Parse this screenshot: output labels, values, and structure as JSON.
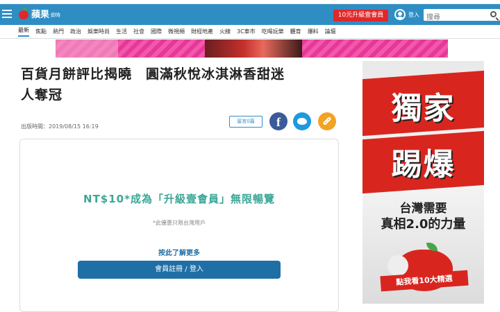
{
  "header": {
    "logo_name": "蘋果",
    "logo_sub": "即時",
    "upgrade_label": "10元升級壹會員",
    "login_label": "登入",
    "search_placeholder": "搜尋"
  },
  "nav": {
    "items": [
      "最新",
      "焦點",
      "熱門",
      "政治",
      "娛樂時尚",
      "生活",
      "社會",
      "國際",
      "微視頻",
      "財經地產",
      "火線",
      "3C車市",
      "吃喝玩樂",
      "體育",
      "爆料",
      "論壇"
    ]
  },
  "article": {
    "headline_line1": "百貨月餅評比揭曉　圓滿秋悅冰淇淋香甜迷",
    "headline_line2": "人奪冠",
    "pubtime": "出版時間：2019/08/15 16:19",
    "comment_label": "留言0篇"
  },
  "paywall": {
    "title": "NT$10*成為「升級壹會員」無限暢覽",
    "note": "*此優惠只限台灣用戶",
    "more_link": "按此了解更多",
    "register_label": "會員註冊 / 登入"
  },
  "ad": {
    "big1": "獨家",
    "big2": "踢爆",
    "tag1": "台灣需要",
    "tag2": "真相2.0的力量",
    "cta": "點我看10大精選"
  },
  "colors": {
    "header_blue": "#2e8ec4",
    "upgrade_red": "#e0282b",
    "paywall_teal": "#3aa796",
    "register_blue": "#1e6fa6",
    "facebook": "#3b5a9a",
    "twitter": "#1d9ae0",
    "link_share": "#f2a323"
  }
}
